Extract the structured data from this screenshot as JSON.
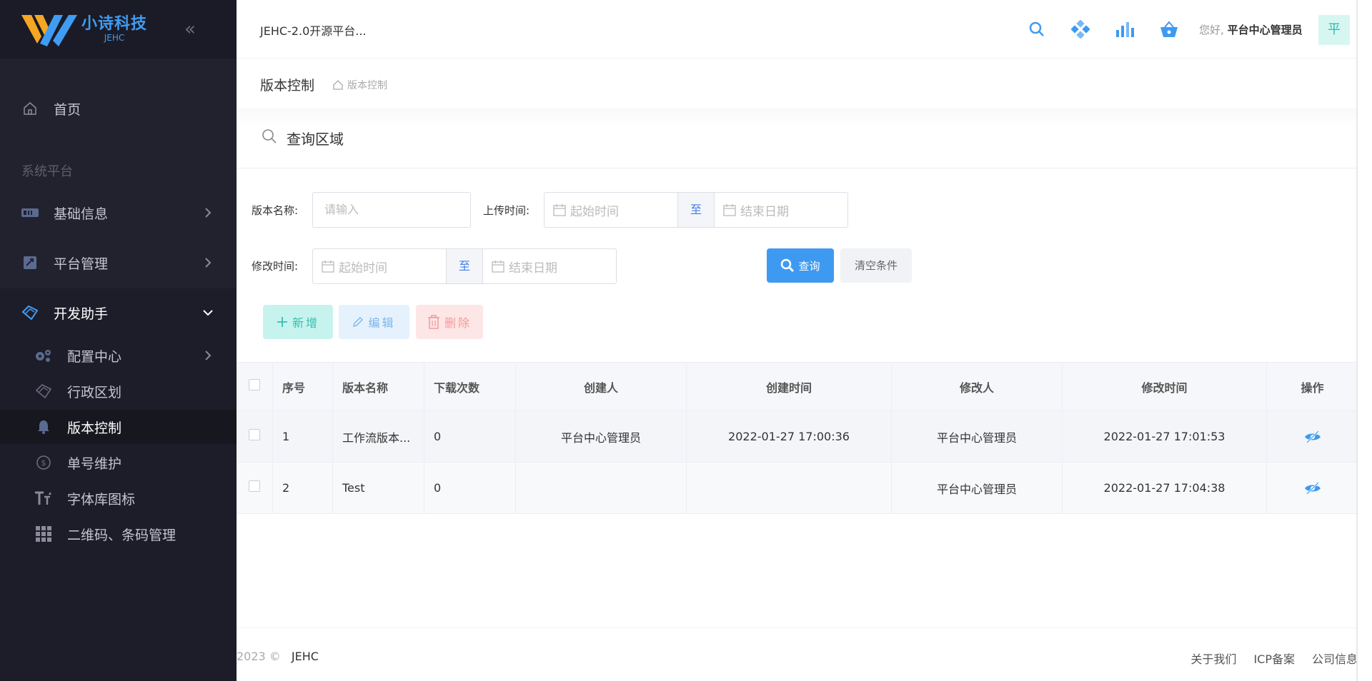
{
  "brand": {
    "name": "小诗科技",
    "sub": "JEHC"
  },
  "header": {
    "app_title": "JEHC-2.0开源平台...",
    "greeting_prefix": "您好,",
    "user_name": "平台中心管理员",
    "avatar_text": "平",
    "icons": [
      "search-icon",
      "apps-icon",
      "chart-icon",
      "basket-icon"
    ]
  },
  "sidebar": {
    "home": "首页",
    "section_label": "系统平台",
    "groups": [
      {
        "label": "基础信息",
        "icon": "id-card-icon"
      },
      {
        "label": "平台管理",
        "icon": "platform-icon"
      },
      {
        "label": "开发助手",
        "icon": "gem-icon",
        "expanded": true
      }
    ],
    "sub_items": [
      {
        "label": "配置中心",
        "icon": "gears-icon"
      },
      {
        "label": "行政区划",
        "icon": "region-icon"
      },
      {
        "label": "版本控制",
        "icon": "bell-icon",
        "active": true
      },
      {
        "label": "单号维护",
        "icon": "number-icon"
      },
      {
        "label": "字体库图标",
        "icon": "font-icon"
      },
      {
        "label": "二维码、条码管理",
        "icon": "grid-icon"
      }
    ]
  },
  "breadcrumb": {
    "page_title": "版本控制",
    "crumb": "版本控制"
  },
  "query": {
    "title": "查询区域",
    "version_name_label": "版本名称:",
    "version_name_placeholder": "请输入",
    "upload_time_label": "上传时间:",
    "modify_time_label": "修改时间:",
    "start_placeholder": "起始时间",
    "end_placeholder": "结束日期",
    "sep": "至",
    "query_button": "查询",
    "clear_button": "清空条件"
  },
  "actions": {
    "add": "新增",
    "edit": "编辑",
    "delete": "删除"
  },
  "table": {
    "headers": [
      "序号",
      "版本名称",
      "下载次数",
      "创建人",
      "创建时间",
      "修改人",
      "修改时间",
      "操作"
    ],
    "rows": [
      {
        "idx": "1",
        "name": "工作流版本...",
        "downloads": "0",
        "creator": "平台中心管理员",
        "created": "2022-01-27 17:00:36",
        "modifier": "平台中心管理员",
        "modified": "2022-01-27 17:01:53"
      },
      {
        "idx": "2",
        "name": "Test",
        "downloads": "0",
        "creator": "",
        "created": "",
        "modifier": "平台中心管理员",
        "modified": "2022-01-27 17:04:38"
      }
    ]
  },
  "footer": {
    "copyright": "2023 ©",
    "brand": "JEHC",
    "links": [
      "关于我们",
      "ICP备案",
      "公司信息"
    ]
  },
  "colors": {
    "primary": "#3e9af1",
    "sidebar_bg": "#22222f",
    "success": "#34bfae",
    "danger": "#f39a9a"
  }
}
